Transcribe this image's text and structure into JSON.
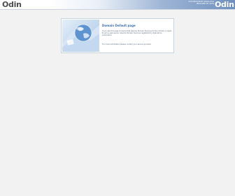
{
  "header": {
    "logo_left": "Odin",
    "tagline_line1": "AUTOMATION BY PARALLELS",
    "tagline_line2": "PROVIDED BY ODIN",
    "logo_right": "Odin"
  },
  "card": {
    "title": "Domain Default page",
    "paragraph1": "If you see this page it means that Apache Domain Services for the domain is ready to add a web server. Apache Domain Services registered by Operations Automation.",
    "paragraph2": "For more information please contact your service provider."
  },
  "colors": {
    "background": "#f2f2f2",
    "accent": "#3a6fb0",
    "header_gradient_end": "#6f8fbe"
  }
}
